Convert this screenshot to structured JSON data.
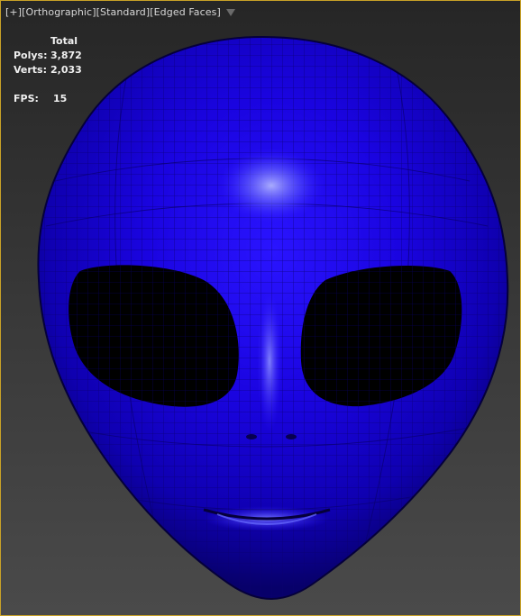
{
  "viewport": {
    "label": {
      "plus": "[+]",
      "view": "[Orthographic]",
      "shading": "[Standard]",
      "mode": "[Edged Faces]",
      "filter_icon": "filter-funnel-icon"
    },
    "stats": {
      "header": "Total",
      "polys_label": "Polys:",
      "polys_value": "3,872",
      "verts_label": "Verts:",
      "verts_value": "2,033",
      "fps_label": "FPS:",
      "fps_value": "15"
    },
    "colors": {
      "frame_border": "#c9a227",
      "model_base": "#1200c8",
      "wire": "#0a006e"
    }
  }
}
